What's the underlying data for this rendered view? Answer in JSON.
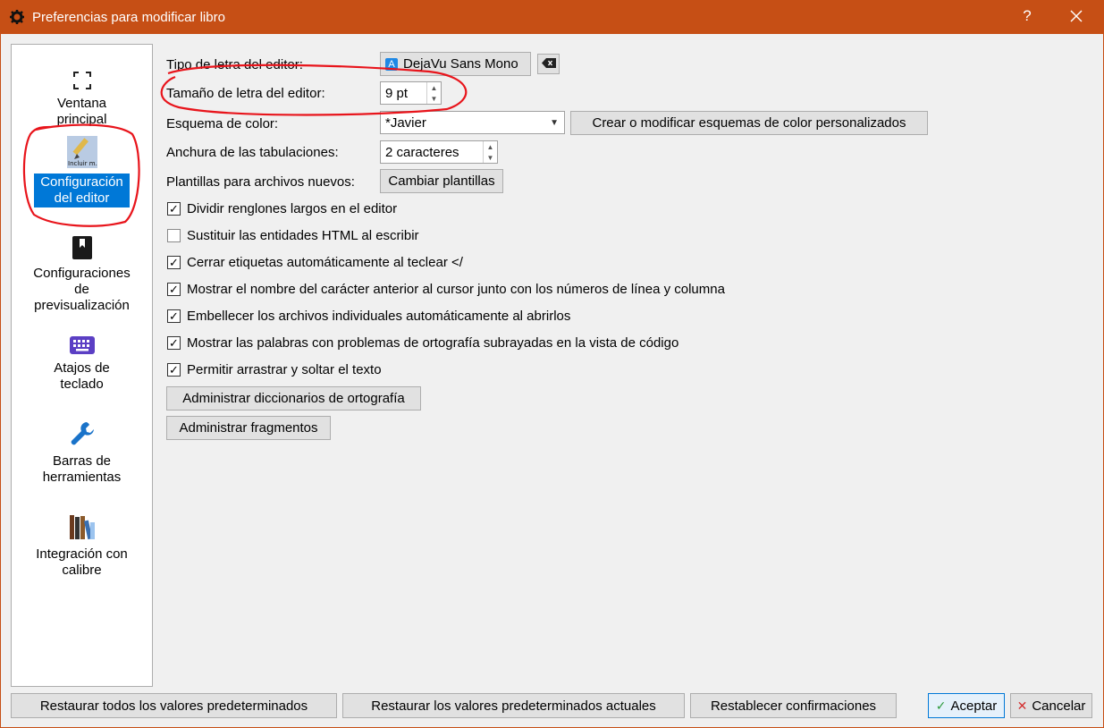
{
  "window": {
    "title": "Preferencias para modificar libro",
    "help_label": "?",
    "close_icon": "close-icon"
  },
  "sidebar": {
    "items": [
      {
        "label": "Ventana principal",
        "icon": "fullscreen-icon"
      },
      {
        "label": "Configuración del editor",
        "icon": "pencil-icon",
        "icon_caption": "Incluir m.",
        "active": true
      },
      {
        "label": "Configuraciones de previsualización",
        "icon": "bookmark-book-icon"
      },
      {
        "label": "Atajos de teclado",
        "icon": "keyboard-icon"
      },
      {
        "label": "Barras de herramientas",
        "icon": "wrench-icon"
      },
      {
        "label": "Integración con calibre",
        "icon": "books-icon"
      }
    ]
  },
  "editor": {
    "font_label": "Tipo de letra del editor:",
    "font_value": "DejaVu Sans Mono",
    "font_size_label": "Tamaño de letra del editor:",
    "font_size_value": "9 pt",
    "color_scheme_label": "Esquema de color:",
    "color_scheme_value": "*Javier",
    "color_scheme_button": "Crear o modificar esquemas de color personalizados",
    "tab_width_label": "Anchura de las tabulaciones:",
    "tab_width_value": "2 caracteres",
    "templates_label": "Plantillas para archivos nuevos:",
    "templates_button": "Cambiar plantillas",
    "checkboxes": [
      {
        "label": "Dividir renglones largos en el editor",
        "checked": true
      },
      {
        "label": "Sustituir las entidades HTML al escribir",
        "checked": false
      },
      {
        "label": "Cerrar etiquetas automáticamente al teclear </",
        "checked": true
      },
      {
        "label": "Mostrar el nombre del carácter anterior al cursor junto con los números de línea y columna",
        "checked": true
      },
      {
        "label": "Embellecer los archivos individuales automáticamente al abrirlos",
        "checked": true
      },
      {
        "label": "Mostrar las palabras con problemas de ortografía subrayadas en la vista de código",
        "checked": true
      },
      {
        "label": "Permitir arrastrar y soltar el texto",
        "checked": true
      }
    ],
    "dictionaries_button": "Administrar diccionarios de ortografía",
    "snippets_button": "Administrar fragmentos"
  },
  "footer": {
    "restore_all": "Restaurar todos los valores predeterminados",
    "restore_current": "Restaurar los valores predeterminados actuales",
    "reset_confirmations": "Restablecer confirmaciones",
    "accept": "Aceptar",
    "cancel": "Cancelar"
  },
  "colors": {
    "titlebar": "#c64f15",
    "selection": "#0078d7",
    "annotation": "#e8141b"
  }
}
